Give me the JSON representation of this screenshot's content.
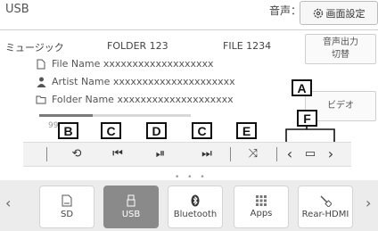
{
  "header": {
    "title": "USB",
    "volume_label": "音声：",
    "settings_label": "画面設定"
  },
  "track": {
    "music_label": "ミュージック",
    "folder_no": "FOLDER 123",
    "file_no": "FILE 1234",
    "file_name": "File Name xxxxxxxxxxxxxxxxxxx",
    "artist_name": "Artist Name xxxxxxxxxxxxxxxxxxxxx",
    "folder_name": "Folder Name xxxxxxxxxxxxxxxxxxxx",
    "elapsed": "99",
    "progress": 0.35
  },
  "side_buttons": {
    "audio_output_line1": "音声出力",
    "audio_output_line2": "切替",
    "video": "ビデオ"
  },
  "tags": {
    "a": "A",
    "b": "B",
    "c": "C",
    "d": "D",
    "e": "E",
    "f": "F"
  },
  "controls": {
    "repeat": "⟲",
    "prev": "⏮",
    "play_pause": "⏯",
    "next": "⏭",
    "shuffle": "⤨",
    "folder_prev": "‹",
    "folder": "▭",
    "folder_next": "›"
  },
  "sources": {
    "left_arrow": "‹",
    "right_arrow": "›",
    "sd": "SD",
    "usb": "USB",
    "bluetooth": "Bluetooth",
    "apps": "Apps",
    "rear_hdmi": "Rear-HDMI"
  },
  "page_dots": "• • •"
}
